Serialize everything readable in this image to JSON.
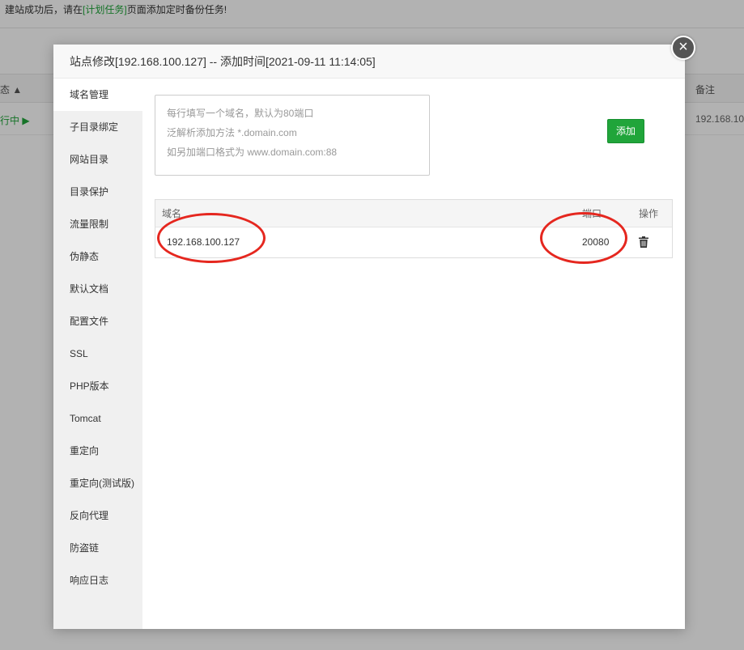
{
  "background": {
    "notice_prefix": "建站成功后，请在",
    "notice_link": "[计划任务]",
    "notice_suffix": "页面添加定时备份任务!",
    "col_status": "态 ▲",
    "col_remark": "备注",
    "row_status": "行中 ▶",
    "row_remark": "192.168.10"
  },
  "dialog": {
    "title": "站点修改[192.168.100.127] -- 添加时间[2021-09-11 11:14:05]",
    "close_label": "×"
  },
  "sidebar": {
    "active_index": 0,
    "items": [
      {
        "label": "域名管理"
      },
      {
        "label": "子目录绑定"
      },
      {
        "label": "网站目录"
      },
      {
        "label": "目录保护"
      },
      {
        "label": "流量限制"
      },
      {
        "label": "伪静态"
      },
      {
        "label": "默认文档"
      },
      {
        "label": "配置文件"
      },
      {
        "label": "SSL"
      },
      {
        "label": "PHP版本"
      },
      {
        "label": "Tomcat"
      },
      {
        "label": "重定向"
      },
      {
        "label": "重定向(测试版)"
      },
      {
        "label": "反向代理"
      },
      {
        "label": "防盗链"
      },
      {
        "label": "响应日志"
      }
    ]
  },
  "domain_form": {
    "placeholder_line1": "每行填写一个域名，默认为80端口",
    "placeholder_line2": "泛解析添加方法 *.domain.com",
    "placeholder_line3": "如另加端口格式为 www.domain.com:88",
    "add_label": "添加"
  },
  "domain_table": {
    "headers": {
      "name": "域名",
      "port": "端口",
      "op": "操作"
    },
    "rows": [
      {
        "name": "192.168.100.127",
        "port": "20080"
      }
    ]
  },
  "colors": {
    "accent": "#20a53a",
    "annotation": "#e5271f"
  },
  "icons": [
    "close-icon",
    "trash-icon"
  ]
}
